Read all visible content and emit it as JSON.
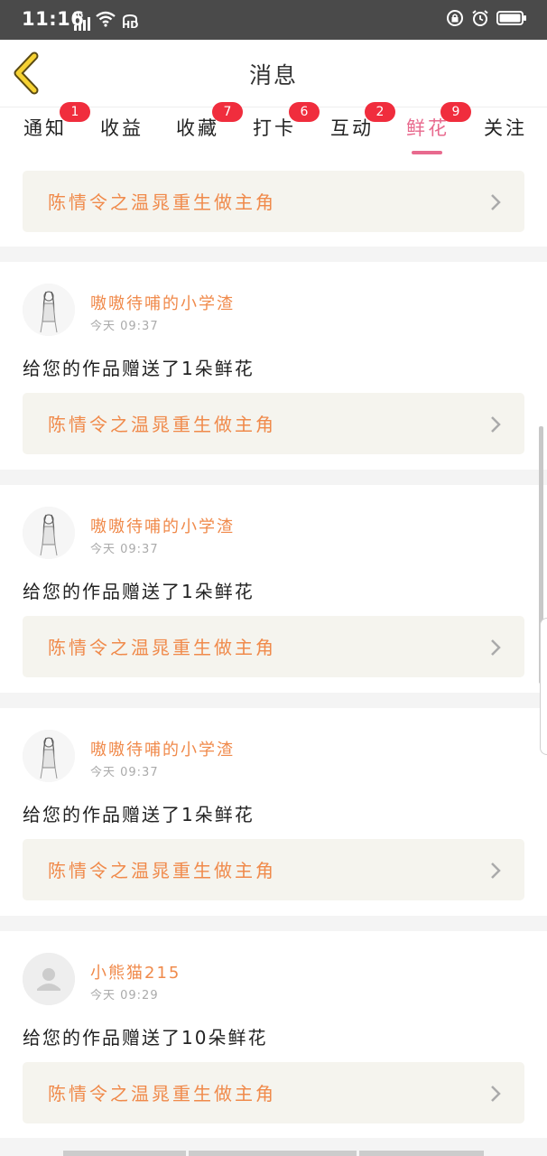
{
  "status_bar": {
    "time": "11:16",
    "network": "4G",
    "hd": "HD"
  },
  "header": {
    "title": "消息"
  },
  "tabs": [
    {
      "label": "通知",
      "badge": "1"
    },
    {
      "label": "收益",
      "badge": ""
    },
    {
      "label": "收藏",
      "badge": "7"
    },
    {
      "label": "打卡",
      "badge": "6"
    },
    {
      "label": "互动",
      "badge": "2"
    },
    {
      "label": "鲜花",
      "badge": "9",
      "active": true
    },
    {
      "label": "关注",
      "badge": ""
    }
  ],
  "colors": {
    "accent": "#e86a8e",
    "badge": "#f02d3d",
    "work_title": "#f08a4b",
    "card_bg": "#f5f4ee",
    "status_bar": "#4a4a4a"
  },
  "top_card": {
    "work_title": "陈情令之温晁重生做主角"
  },
  "messages": [
    {
      "user": "嗷嗷待哺的小学渣",
      "time": "今天 09:37",
      "text": "给您的作品赠送了1朵鲜花",
      "work_title": "陈情令之温晁重生做主角",
      "avatar": "sketch-avatar"
    },
    {
      "user": "嗷嗷待哺的小学渣",
      "time": "今天 09:37",
      "text": "给您的作品赠送了1朵鲜花",
      "work_title": "陈情令之温晁重生做主角",
      "avatar": "sketch-avatar"
    },
    {
      "user": "嗷嗷待哺的小学渣",
      "time": "今天 09:37",
      "text": "给您的作品赠送了1朵鲜花",
      "work_title": "陈情令之温晁重生做主角",
      "avatar": "sketch-avatar"
    },
    {
      "user": "小熊猫215",
      "time": "今天 09:29",
      "text": "给您的作品赠送了10朵鲜花",
      "work_title": "陈情令之温晁重生做主角",
      "avatar": "default-avatar"
    }
  ]
}
